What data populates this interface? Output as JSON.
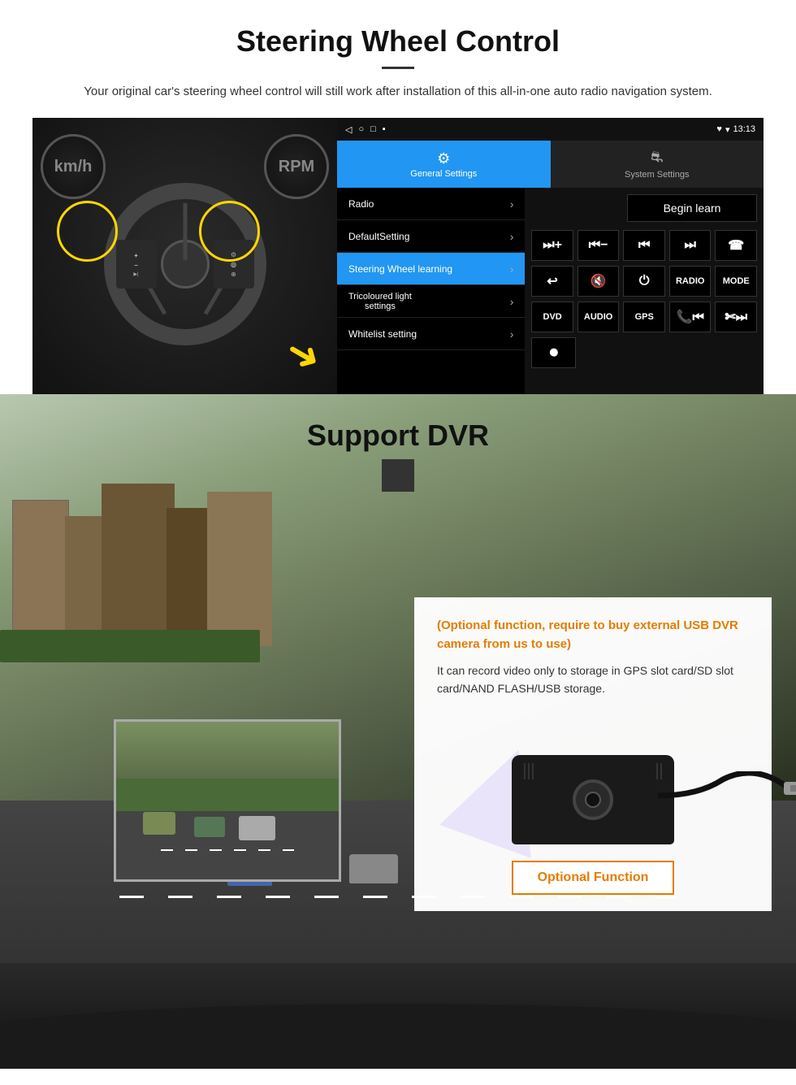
{
  "page": {
    "section1": {
      "title": "Steering Wheel Control",
      "subtitle": "Your original car's steering wheel control will still work after installation of this all-in-one auto radio navigation system.",
      "android_panel": {
        "statusbar": {
          "nav_back": "◁",
          "nav_home": "○",
          "nav_recent": "□",
          "nav_cast": "▪",
          "signal": "♥",
          "wifi": "▾",
          "time": "13:13"
        },
        "tabs": [
          {
            "id": "general",
            "icon": "⚙",
            "label": "General Settings",
            "active": true
          },
          {
            "id": "system",
            "icon": "⛐",
            "label": "System Settings",
            "active": false
          }
        ],
        "menu_items": [
          {
            "label": "Radio",
            "active": false
          },
          {
            "label": "DefaultSetting",
            "active": false
          },
          {
            "label": "Steering Wheel learning",
            "active": true
          },
          {
            "label": "Tricoloured light settings",
            "active": false
          },
          {
            "label": "Whitelist setting",
            "active": false
          }
        ]
      },
      "controls": {
        "begin_learn": "Begin learn",
        "row1": [
          "⏮+",
          "⏮−",
          "⏮⏮",
          "⏭⏭",
          "☎"
        ],
        "row2": [
          "↩",
          "🔇×",
          "⏻",
          "RADIO",
          "MODE"
        ],
        "row3": [
          "DVD",
          "AUDIO",
          "GPS",
          "📞⏮",
          "✄⏭"
        ],
        "row4": [
          "⏺"
        ]
      }
    },
    "section2": {
      "title": "Support DVR",
      "optional_text": "(Optional function, require to buy external USB DVR camera from us to use)",
      "desc_text": "It can record video only to storage in GPS slot card/SD slot card/NAND FLASH/USB storage.",
      "optional_function_label": "Optional Function"
    }
  }
}
